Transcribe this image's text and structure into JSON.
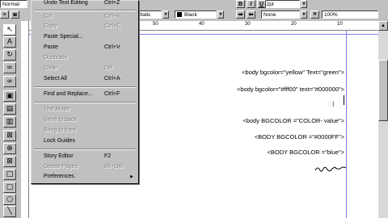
{
  "toolbar": {
    "style_value": "Normal",
    "font_value": "Italic",
    "size_value": "12pt",
    "color_value": "Black",
    "line_value": "None",
    "percent_value": "100%",
    "bold_label": "B",
    "italic_label": "I",
    "underline_label": "U"
  },
  "ruler": {
    "marks": [
      "50",
      "40",
      "30",
      "20",
      "10"
    ]
  },
  "document": {
    "lines": [
      "<body bgcolor=\"yellow\" Text=\"green\">",
      "<body bgcolor=\"#fff00\" text=\"#000000\">",
      "<body BGCOLOR =\"COLOR- value\">",
      "<BODY BGCOLOR =\"#0000FF\">",
      "<BODY BGCOLOR =\"blue\">"
    ]
  },
  "edit_menu": {
    "items": [
      {
        "label": "Undo Text Editing",
        "shortcut": "Ctrl+Z",
        "enabled": true
      },
      {
        "label": "Cut",
        "shortcut": "Ctrl+X",
        "enabled": false
      },
      {
        "label": "Copy",
        "shortcut": "Ctrl+C",
        "enabled": false
      },
      {
        "label": "Paste Special...",
        "shortcut": "",
        "enabled": true
      },
      {
        "label": "Paste",
        "shortcut": "Ctrl+V",
        "enabled": true
      },
      {
        "label": "Duplicate",
        "shortcut": "",
        "enabled": false
      },
      {
        "label": "Clear",
        "shortcut": "Del",
        "enabled": false
      },
      {
        "label": "Select All",
        "shortcut": "Ctrl+A",
        "enabled": true
      },
      {
        "label": "Find and Replace...",
        "shortcut": "Ctrl+F",
        "enabled": true
      },
      {
        "label": "Text Mode",
        "shortcut": "",
        "enabled": false
      },
      {
        "label": "Send to back",
        "shortcut": "",
        "enabled": false
      },
      {
        "label": "Bring to front",
        "shortcut": "",
        "enabled": false
      },
      {
        "label": "Lock Guides",
        "shortcut": "",
        "enabled": true
      },
      {
        "label": "Story Editor",
        "shortcut": "F2",
        "enabled": true
      },
      {
        "label": "Delete Pages",
        "shortcut": "Alt+Del",
        "enabled": false
      },
      {
        "label": "Preferences",
        "shortcut": "",
        "enabled": true
      }
    ]
  },
  "colors": {
    "guide": "#7f7fff",
    "menu_bg": "#c0c0c0",
    "disabled_text": "#808080"
  },
  "icons": {
    "tools": [
      "pointer-icon",
      "text-tool-icon",
      "rotate-icon",
      "link-icon",
      "unlink-icon",
      "frame-icon",
      "text-frame-icon",
      "image-frame-icon",
      "crossed-box-icon",
      "crossed-circle-icon",
      "crossed-square-icon",
      "rectangle-icon",
      "rounded-rect-icon",
      "ellipse-icon",
      "line-icon",
      "polygon-icon"
    ]
  }
}
